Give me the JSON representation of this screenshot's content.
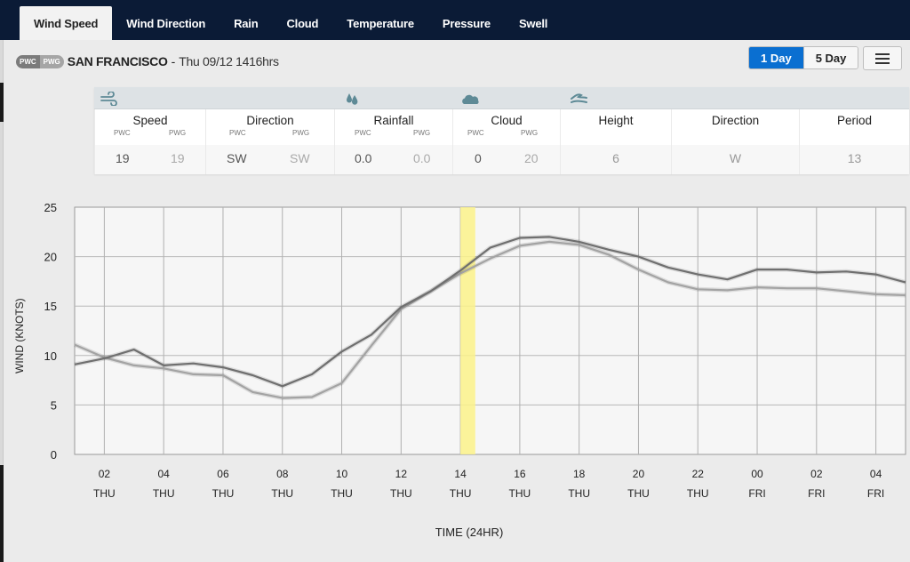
{
  "tabs": [
    {
      "label": "Wind Speed",
      "active": true
    },
    {
      "label": "Wind Direction",
      "active": false
    },
    {
      "label": "Rain",
      "active": false
    },
    {
      "label": "Cloud",
      "active": false
    },
    {
      "label": "Temperature",
      "active": false
    },
    {
      "label": "Pressure",
      "active": false
    },
    {
      "label": "Swell",
      "active": false
    }
  ],
  "location": {
    "badge_left": "PWC",
    "badge_right": "PWG",
    "name": "SAN FRANCISCO",
    "separator": "-",
    "datetime": "Thu 09/12 1416hrs"
  },
  "range_buttons": [
    {
      "label": "1 Day",
      "active": true
    },
    {
      "label": "5 Day",
      "active": false
    }
  ],
  "menu_icon": "hamburger-menu-icon",
  "colors": {
    "topbar": "#0b1b36",
    "active_button": "#0a6fd1",
    "icon_teal": "#5e8a96",
    "highlight": "#fbf28a",
    "series_dark": "#6f6f6f",
    "series_light": "#a3a3a3"
  },
  "summary": {
    "icons": [
      "wind-icon",
      "rain-drops-icon",
      "cloud-icon",
      "swell-waves-icon"
    ],
    "speed": {
      "title": "Speed",
      "sub_pwc": "PWC",
      "sub_pwg": "PWG",
      "pwc": "19",
      "pwg": "19"
    },
    "direction": {
      "title": "Direction",
      "sub_pwc": "PWC",
      "sub_pwg": "PWG",
      "pwc": "SW",
      "pwg": "SW"
    },
    "rainfall": {
      "title": "Rainfall",
      "sub_pwc": "PWC",
      "sub_pwg": "PWG",
      "pwc": "0.0",
      "pwg": "0.0"
    },
    "cloud": {
      "title": "Cloud",
      "sub_pwc": "PWC",
      "sub_pwg": "PWG",
      "pwc": "0",
      "pwg": "20"
    },
    "swell_height": {
      "title": "Height",
      "value": "6"
    },
    "swell_direction": {
      "title": "Direction",
      "value": "W"
    },
    "swell_period": {
      "title": "Period",
      "value": "13"
    }
  },
  "chart_data": {
    "type": "line",
    "title": "",
    "xlabel": "TIME (24HR)",
    "ylabel": "WIND (KNOTS)",
    "ylim": [
      0,
      25
    ],
    "yticks": [
      0,
      5,
      10,
      15,
      20,
      25
    ],
    "xlim_hours": [
      1,
      29
    ],
    "grid": true,
    "x_ticks": [
      {
        "hour": 2,
        "time": "02",
        "day": "THU"
      },
      {
        "hour": 4,
        "time": "04",
        "day": "THU"
      },
      {
        "hour": 6,
        "time": "06",
        "day": "THU"
      },
      {
        "hour": 8,
        "time": "08",
        "day": "THU"
      },
      {
        "hour": 10,
        "time": "10",
        "day": "THU"
      },
      {
        "hour": 12,
        "time": "12",
        "day": "THU"
      },
      {
        "hour": 14,
        "time": "14",
        "day": "THU"
      },
      {
        "hour": 16,
        "time": "16",
        "day": "THU"
      },
      {
        "hour": 18,
        "time": "18",
        "day": "THU"
      },
      {
        "hour": 20,
        "time": "20",
        "day": "THU"
      },
      {
        "hour": 22,
        "time": "22",
        "day": "THU"
      },
      {
        "hour": 24,
        "time": "00",
        "day": "FRI"
      },
      {
        "hour": 26,
        "time": "02",
        "day": "FRI"
      },
      {
        "hour": 28,
        "time": "04",
        "day": "FRI"
      }
    ],
    "x_hours": [
      1,
      2,
      3,
      4,
      5,
      6,
      7,
      8,
      9,
      10,
      11,
      12,
      13,
      14,
      15,
      16,
      17,
      18,
      19,
      20,
      21,
      22,
      23,
      24,
      25,
      26,
      27,
      28,
      29
    ],
    "current_time_band_hours": [
      14.0,
      14.5
    ],
    "series": [
      {
        "name": "PWC",
        "color": "#6f6f6f",
        "values": [
          9.1,
          9.7,
          10.6,
          9.0,
          9.2,
          8.8,
          8.0,
          6.9,
          8.1,
          10.4,
          12.1,
          14.9,
          16.5,
          18.6,
          20.9,
          21.9,
          22.0,
          21.5,
          20.7,
          20.0,
          18.9,
          18.2,
          17.7,
          18.7,
          18.7,
          18.4,
          18.5,
          18.2,
          17.4
        ]
      },
      {
        "name": "PWG",
        "color": "#a3a3a3",
        "values": [
          11.1,
          9.8,
          9.0,
          8.7,
          8.1,
          8.0,
          6.3,
          5.7,
          5.8,
          7.2,
          11.0,
          14.7,
          16.5,
          18.3,
          19.8,
          21.1,
          21.5,
          21.2,
          20.2,
          18.7,
          17.4,
          16.7,
          16.6,
          16.9,
          16.8,
          16.8,
          16.5,
          16.2,
          16.1
        ]
      }
    ]
  }
}
